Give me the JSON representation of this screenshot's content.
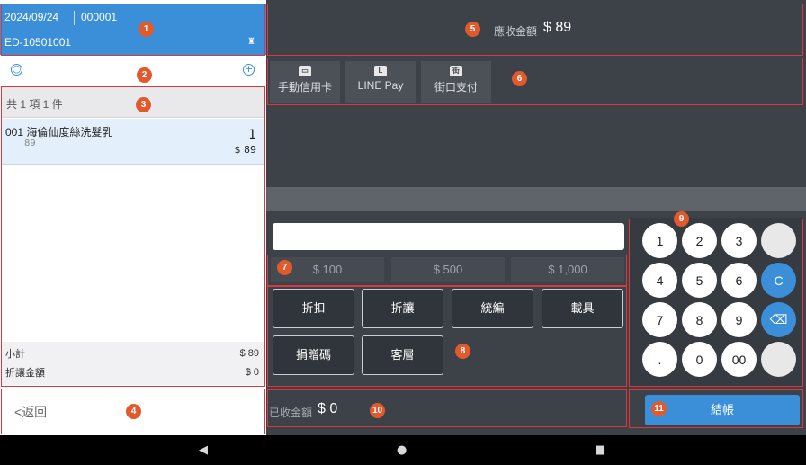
{
  "header": {
    "date": "2024/09/24",
    "order_no": "000001",
    "device_id": "ED-10501001"
  },
  "cart": {
    "summary": "共 1 項 1 件",
    "items": [
      {
        "code": "001",
        "name": "海倫仙度絲洗髮乳",
        "unit_price": "89",
        "qty": "1",
        "total": "$ 89"
      }
    ],
    "subtotal_label": "小計",
    "subtotal": "$ 89",
    "discount_label": "折讓金額",
    "discount": "$ 0",
    "back_label": "返回"
  },
  "amount_due": {
    "label": "應收金額",
    "value": "$ 89"
  },
  "payment_methods": [
    {
      "label": "手動信用卡",
      "icon": "credit-card-icon"
    },
    {
      "label": "LINE Pay",
      "icon": "line-pay-icon"
    },
    {
      "label": "街口支付",
      "icon": "jkos-icon"
    }
  ],
  "quick_amounts": [
    "$ 100",
    "$ 500",
    "$ 1,000"
  ],
  "functions": [
    "折扣",
    "折讓",
    "統編",
    "載具",
    "捐贈碼",
    "客層"
  ],
  "keypad": [
    "1",
    "2",
    "3",
    "",
    "4",
    "5",
    "6",
    "C",
    "7",
    "8",
    "9",
    "⌫",
    ".",
    "0",
    "00",
    ""
  ],
  "received": {
    "label": "已收金額",
    "value": "$ 0"
  },
  "checkout_label": "結帳",
  "badges": [
    "1",
    "2",
    "3",
    "4",
    "5",
    "6",
    "7",
    "8",
    "9",
    "10",
    "11"
  ],
  "colors": {
    "accent": "#3b8fd9",
    "badge": "#e25a2c",
    "highlight": "#d9383e",
    "panel": "#3c4248"
  }
}
